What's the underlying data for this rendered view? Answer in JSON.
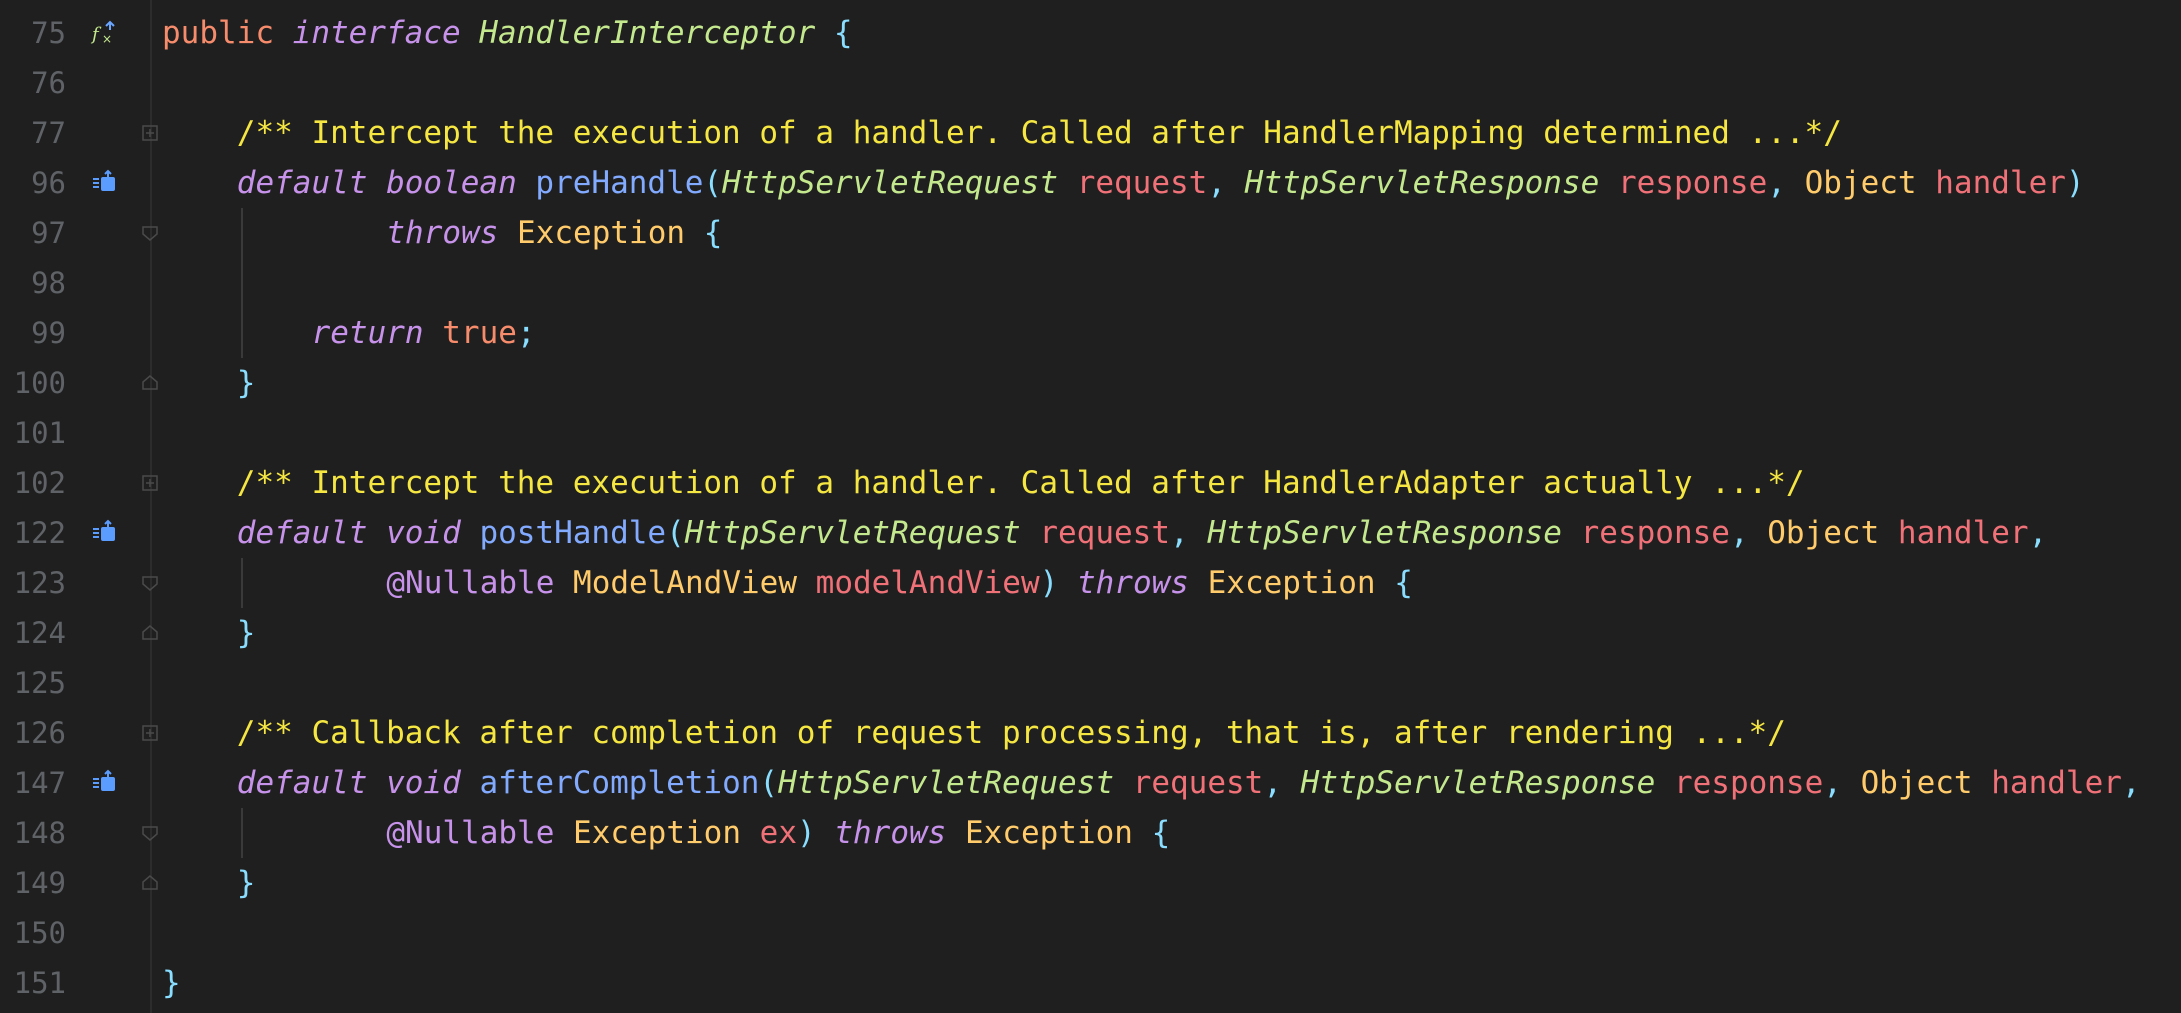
{
  "editor": {
    "language": "java",
    "colors": {
      "background": "#1f1f1f",
      "line_number": "#5f6266",
      "keyword": "#c792ea",
      "type": "#c3e88d",
      "class": "#ffcb6b",
      "parameter": "#f07178",
      "function": "#82aaff",
      "comment": "#f5e642",
      "punctuation": "#89ddff"
    },
    "lines": [
      {
        "number": "75",
        "marker": "implemented-icon",
        "tokens": [
          {
            "t": "public ",
            "c": "kwr"
          },
          {
            "t": "interface ",
            "c": "kw"
          },
          {
            "t": "HandlerInterceptor",
            "c": "iface"
          },
          {
            "t": " {",
            "c": "punc"
          }
        ]
      },
      {
        "number": "76",
        "tokens": []
      },
      {
        "number": "77",
        "fold": "collapsed",
        "indent": 1,
        "tokens": [
          {
            "t": "/** Intercept the execution of a handler. Called after HandlerMapping determined ...*/",
            "c": "cmt"
          }
        ]
      },
      {
        "number": "96",
        "marker": "override-icon",
        "indent": 1,
        "tokens": [
          {
            "t": "default ",
            "c": "kw"
          },
          {
            "t": "boolean ",
            "c": "kw"
          },
          {
            "t": "preHandle",
            "c": "fn"
          },
          {
            "t": "(",
            "c": "punc"
          },
          {
            "t": "HttpServletRequest ",
            "c": "type"
          },
          {
            "t": "request",
            "c": "param"
          },
          {
            "t": ", ",
            "c": "punc"
          },
          {
            "t": "HttpServletResponse ",
            "c": "type"
          },
          {
            "t": "response",
            "c": "param"
          },
          {
            "t": ", ",
            "c": "punc"
          },
          {
            "t": "Object ",
            "c": "cls"
          },
          {
            "t": "handler",
            "c": "param"
          },
          {
            "t": ")",
            "c": "punc"
          }
        ]
      },
      {
        "number": "97",
        "fold": "open",
        "indent": 3,
        "tokens": [
          {
            "t": "throws ",
            "c": "kw"
          },
          {
            "t": "Exception",
            "c": "cls"
          },
          {
            "t": " {",
            "c": "punc"
          }
        ]
      },
      {
        "number": "98",
        "tokens": []
      },
      {
        "number": "99",
        "indent": 2,
        "tokens": [
          {
            "t": "return ",
            "c": "kw"
          },
          {
            "t": "true",
            "c": "kwr"
          },
          {
            "t": ";",
            "c": "punc"
          }
        ]
      },
      {
        "number": "100",
        "fold": "close",
        "indent": 1,
        "tokens": [
          {
            "t": "}",
            "c": "punc"
          }
        ]
      },
      {
        "number": "101",
        "tokens": []
      },
      {
        "number": "102",
        "fold": "collapsed",
        "indent": 1,
        "tokens": [
          {
            "t": "/** Intercept the execution of a handler. Called after HandlerAdapter actually ...*/",
            "c": "cmt"
          }
        ]
      },
      {
        "number": "122",
        "marker": "override-icon",
        "indent": 1,
        "tokens": [
          {
            "t": "default ",
            "c": "kw"
          },
          {
            "t": "void ",
            "c": "kw"
          },
          {
            "t": "postHandle",
            "c": "fn"
          },
          {
            "t": "(",
            "c": "punc"
          },
          {
            "t": "HttpServletRequest ",
            "c": "type"
          },
          {
            "t": "request",
            "c": "param"
          },
          {
            "t": ", ",
            "c": "punc"
          },
          {
            "t": "HttpServletResponse ",
            "c": "type"
          },
          {
            "t": "response",
            "c": "param"
          },
          {
            "t": ", ",
            "c": "punc"
          },
          {
            "t": "Object ",
            "c": "cls"
          },
          {
            "t": "handler",
            "c": "param"
          },
          {
            "t": ",",
            "c": "punc"
          }
        ]
      },
      {
        "number": "123",
        "fold": "open",
        "indent": 3,
        "tokens": [
          {
            "t": "@Nullable ",
            "c": "ann"
          },
          {
            "t": "ModelAndView ",
            "c": "cls"
          },
          {
            "t": "modelAndView",
            "c": "param"
          },
          {
            "t": ") ",
            "c": "punc"
          },
          {
            "t": "throws ",
            "c": "kw"
          },
          {
            "t": "Exception",
            "c": "cls"
          },
          {
            "t": " {",
            "c": "punc"
          }
        ]
      },
      {
        "number": "124",
        "fold": "close",
        "indent": 1,
        "tokens": [
          {
            "t": "}",
            "c": "punc"
          }
        ]
      },
      {
        "number": "125",
        "tokens": []
      },
      {
        "number": "126",
        "fold": "collapsed",
        "indent": 1,
        "tokens": [
          {
            "t": "/** Callback after completion of request processing, that is, after rendering ...*/",
            "c": "cmt"
          }
        ]
      },
      {
        "number": "147",
        "marker": "override-icon",
        "indent": 1,
        "tokens": [
          {
            "t": "default ",
            "c": "kw"
          },
          {
            "t": "void ",
            "c": "kw"
          },
          {
            "t": "afterCompletion",
            "c": "fn"
          },
          {
            "t": "(",
            "c": "punc"
          },
          {
            "t": "HttpServletRequest ",
            "c": "type"
          },
          {
            "t": "request",
            "c": "param"
          },
          {
            "t": ", ",
            "c": "punc"
          },
          {
            "t": "HttpServletResponse ",
            "c": "type"
          },
          {
            "t": "response",
            "c": "param"
          },
          {
            "t": ", ",
            "c": "punc"
          },
          {
            "t": "Object ",
            "c": "cls"
          },
          {
            "t": "handler",
            "c": "param"
          },
          {
            "t": ",",
            "c": "punc"
          }
        ]
      },
      {
        "number": "148",
        "fold": "open",
        "indent": 3,
        "tokens": [
          {
            "t": "@Nullable ",
            "c": "ann"
          },
          {
            "t": "Exception ",
            "c": "cls"
          },
          {
            "t": "ex",
            "c": "param"
          },
          {
            "t": ") ",
            "c": "punc"
          },
          {
            "t": "throws ",
            "c": "kw"
          },
          {
            "t": "Exception",
            "c": "cls"
          },
          {
            "t": " {",
            "c": "punc"
          }
        ]
      },
      {
        "number": "149",
        "fold": "close",
        "indent": 1,
        "tokens": [
          {
            "t": "}",
            "c": "punc"
          }
        ]
      },
      {
        "number": "150",
        "tokens": []
      },
      {
        "number": "151",
        "tokens": [
          {
            "t": "}",
            "c": "punc"
          }
        ]
      }
    ]
  }
}
